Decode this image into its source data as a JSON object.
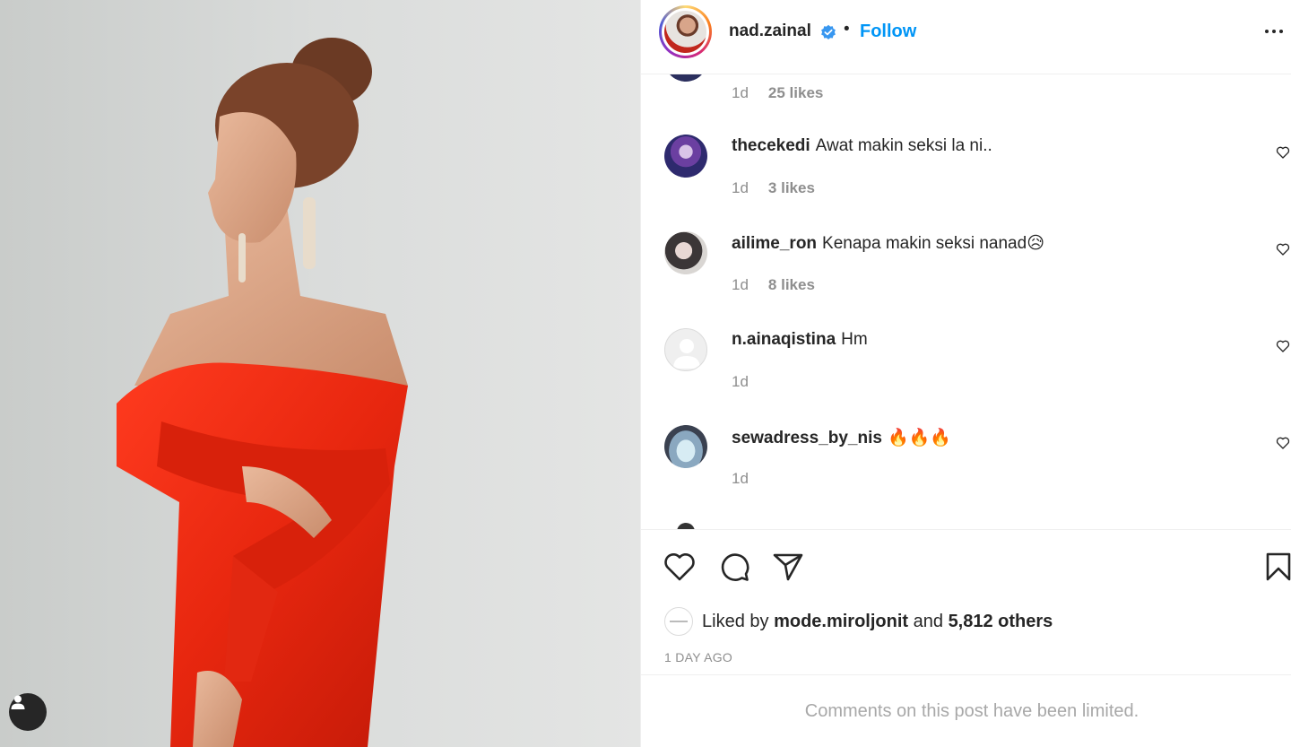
{
  "post": {
    "author": "nad.zainal",
    "follow_label": "Follow",
    "separator": "•",
    "verified": true
  },
  "icons": {
    "verified": "verified-badge-icon",
    "more": "more-options-icon",
    "tag": "user-tag-icon",
    "like": "heart-icon",
    "comment": "comment-bubble-icon",
    "share": "paper-plane-icon",
    "save": "bookmark-icon"
  },
  "colors": {
    "accent": "#0095f6",
    "verified": "#3897f0",
    "text": "#262626",
    "muted": "#8e8e8e"
  },
  "partial_comment": {
    "time": "1d",
    "likes": "25 likes"
  },
  "comments": [
    {
      "user": "thecekedi",
      "text": "Awat makin seksi la ni..",
      "time": "1d",
      "likes": "3 likes"
    },
    {
      "user": "ailime_ron",
      "text": "Kenapa makin seksi nanad😥",
      "time": "1d",
      "likes": "8 likes"
    },
    {
      "user": "n.ainaqistina",
      "text": "Hm",
      "time": "1d",
      "likes": ""
    },
    {
      "user": "sewadress_by_nis",
      "text": "🔥🔥🔥",
      "time": "1d",
      "likes": ""
    }
  ],
  "likes": {
    "prefix": "Liked by",
    "user": "mode.miroljonit",
    "conjunction": "and",
    "others": "5,812 others"
  },
  "timestamp": "1 DAY AGO",
  "limited_notice": "Comments on this post have been limited."
}
